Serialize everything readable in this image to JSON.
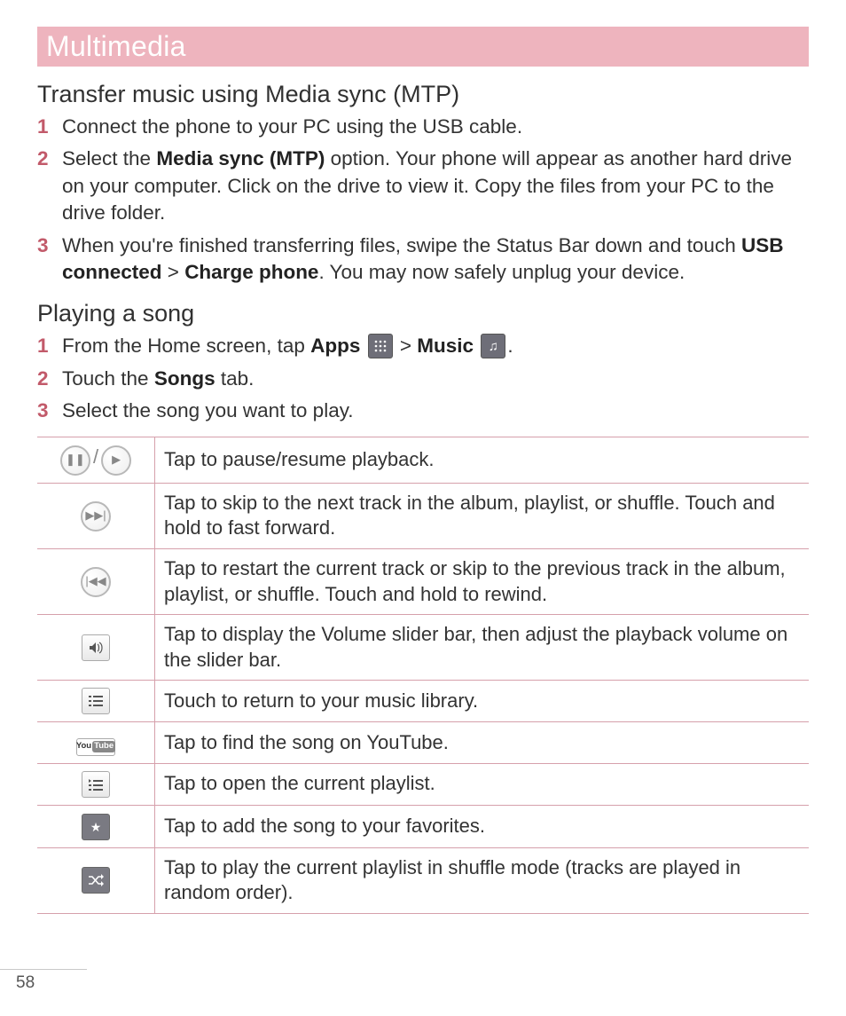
{
  "chapter": "Multimedia",
  "section1": {
    "heading": "Transfer music using Media sync (MTP)",
    "steps": [
      {
        "n": "1",
        "pre": "Connect the phone to your PC using the USB cable."
      },
      {
        "n": "2",
        "pre": "Select the ",
        "b1": "Media sync (MTP)",
        "post1": " option. Your phone will appear as another hard drive on your computer. Click on the drive to view it. Copy the files from your PC to the drive folder."
      },
      {
        "n": "3",
        "pre": "When you're finished transferring files, swipe the Status Bar down and touch ",
        "b1": "USB connected",
        "mid": " > ",
        "b2": "Charge phone",
        "post2": ". You may now safely unplug your device."
      }
    ]
  },
  "section2": {
    "heading": "Playing a song",
    "steps": [
      {
        "n": "1",
        "pre": "From the Home screen, tap ",
        "b1": "Apps",
        "gt": " > ",
        "b2": "Music",
        "dot": "."
      },
      {
        "n": "2",
        "pre": "Touch the ",
        "b1": "Songs",
        "post1": " tab."
      },
      {
        "n": "3",
        "pre": "Select the song you want to play."
      }
    ]
  },
  "table": [
    {
      "icon": "pause-play",
      "desc": "Tap to pause/resume playback."
    },
    {
      "icon": "next",
      "desc": "Tap to skip to the next track in the album, playlist, or shuffle. Touch and hold to fast forward."
    },
    {
      "icon": "prev",
      "desc": "Tap to restart the current track or skip to the previous track in the album, playlist, or shuffle. Touch and hold to rewind."
    },
    {
      "icon": "volume",
      "desc": "Tap to display the Volume slider bar, then adjust the playback volume on the slider bar."
    },
    {
      "icon": "library",
      "desc": "Touch to return to your music library."
    },
    {
      "icon": "youtube",
      "desc": "Tap to find the song on YouTube."
    },
    {
      "icon": "playlist",
      "desc": "Tap to open the current playlist."
    },
    {
      "icon": "favorite",
      "desc": "Tap to add the song to your favorites."
    },
    {
      "icon": "shuffle",
      "desc": "Tap to play the current playlist in shuffle mode (tracks are played in random order)."
    }
  ],
  "pageNumber": "58"
}
